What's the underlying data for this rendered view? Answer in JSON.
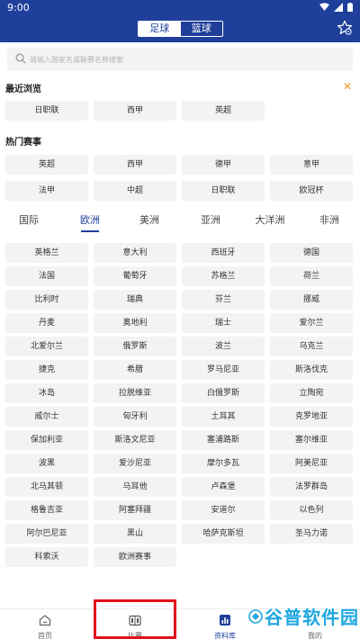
{
  "status_bar": {
    "time": "9:00"
  },
  "header": {
    "tabs": [
      {
        "label": "足球",
        "active": true
      },
      {
        "label": "篮球",
        "active": false
      }
    ]
  },
  "search": {
    "placeholder": "请输入国家名或联赛名称搜索"
  },
  "recent": {
    "title": "最近浏览",
    "items": [
      "日职联",
      "西甲",
      "英超"
    ]
  },
  "hot": {
    "title": "热门赛事",
    "items": [
      "英超",
      "西甲",
      "德甲",
      "意甲",
      "法甲",
      "中超",
      "日职联",
      "欧冠杯"
    ]
  },
  "region_tabs": {
    "items": [
      "国际",
      "欧洲",
      "美洲",
      "亚洲",
      "大洋洲",
      "非洲"
    ],
    "active_index": 1
  },
  "countries": [
    "英格兰",
    "意大利",
    "西班牙",
    "德国",
    "法国",
    "葡萄牙",
    "苏格兰",
    "荷兰",
    "比利时",
    "瑞典",
    "芬兰",
    "挪威",
    "丹麦",
    "奥地利",
    "瑞士",
    "爱尔兰",
    "北爱尔兰",
    "俄罗斯",
    "波兰",
    "乌克兰",
    "捷克",
    "希腊",
    "罗马尼亚",
    "斯洛伐克",
    "冰岛",
    "拉脱维亚",
    "白俄罗斯",
    "立陶宛",
    "威尔士",
    "匈牙利",
    "土耳其",
    "克罗地亚",
    "保加利亚",
    "斯洛文尼亚",
    "塞浦路斯",
    "塞尔维亚",
    "波黑",
    "爱沙尼亚",
    "摩尔多瓦",
    "阿美尼亚",
    "北马其顿",
    "马耳他",
    "卢森堡",
    "法罗群岛",
    "格鲁吉亚",
    "阿塞拜疆",
    "安道尔",
    "以色列",
    "阿尔巴尼亚",
    "黑山",
    "哈萨克斯坦",
    "圣马力诺",
    "科索沃",
    "欧洲赛事"
  ],
  "bottom_nav": {
    "items": [
      {
        "label": "首页",
        "icon": "home-icon"
      },
      {
        "label": "比赛",
        "icon": "scoreboard-icon"
      },
      {
        "label": "资料库",
        "icon": "bar-chart-icon",
        "active": true
      },
      {
        "label": "我的",
        "icon": "user-icon"
      }
    ]
  },
  "watermark": {
    "text": "谷普软件园"
  },
  "colors": {
    "primary": "#1f3f9b",
    "accent": "#f39b2b",
    "highlight_box": "#e3101b",
    "watermark": "#1fa7df"
  }
}
